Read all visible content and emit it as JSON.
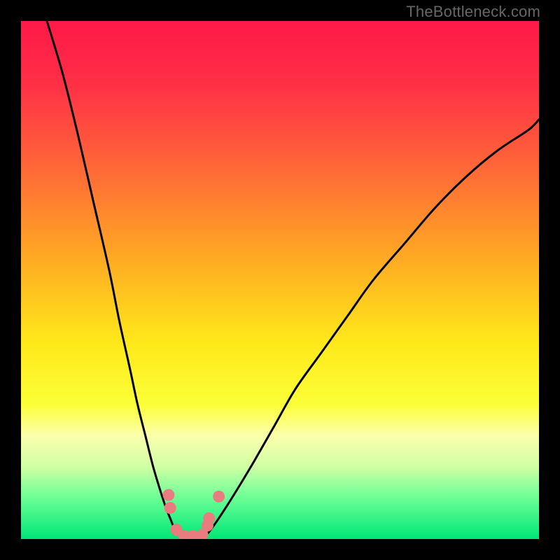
{
  "watermark": "TheBottleneck.com",
  "colors": {
    "black": "#000000",
    "curve": "#000000",
    "dot": "#e97c7e",
    "grad_stops": [
      {
        "p": 0.0,
        "c": "#ff1948"
      },
      {
        "p": 0.12,
        "c": "#ff2f46"
      },
      {
        "p": 0.28,
        "c": "#ff6638"
      },
      {
        "p": 0.45,
        "c": "#ffa724"
      },
      {
        "p": 0.62,
        "c": "#ffe81a"
      },
      {
        "p": 0.74,
        "c": "#fbff37"
      },
      {
        "p": 0.8,
        "c": "#fcffac"
      },
      {
        "p": 0.86,
        "c": "#d0ffa4"
      },
      {
        "p": 0.92,
        "c": "#6cff96"
      },
      {
        "p": 1.0,
        "c": "#00e676"
      }
    ]
  },
  "chart_data": {
    "type": "line",
    "title": "",
    "xlabel": "",
    "ylabel": "",
    "xlim": [
      0,
      100
    ],
    "ylim": [
      0,
      100
    ],
    "series": [
      {
        "name": "left-branch",
        "x": [
          5,
          8,
          11,
          14,
          17,
          19,
          21,
          22.5,
          24,
          25.5,
          27,
          28,
          28.8,
          29.4,
          30,
          30.5,
          31
        ],
        "y": [
          100,
          90,
          78,
          65,
          52,
          42,
          33,
          26,
          20,
          14,
          9,
          6,
          4,
          2.5,
          1.5,
          0.8,
          0
        ]
      },
      {
        "name": "right-branch",
        "x": [
          35,
          36,
          37.5,
          39.5,
          42,
          45,
          49,
          53,
          58,
          63,
          68,
          74,
          80,
          86,
          92,
          98,
          100
        ],
        "y": [
          0,
          1,
          3,
          6,
          10,
          15,
          22,
          29,
          36,
          43,
          50,
          57,
          64,
          70,
          75,
          79,
          81
        ]
      }
    ],
    "valley_floor": {
      "x_start": 31,
      "x_end": 35,
      "y": 0
    },
    "dots": [
      {
        "x": 28.5,
        "y": 8.5
      },
      {
        "x": 28.8,
        "y": 6.0
      },
      {
        "x": 30.0,
        "y": 1.8
      },
      {
        "x": 31.5,
        "y": 0.6
      },
      {
        "x": 33.2,
        "y": 0.6
      },
      {
        "x": 35.0,
        "y": 0.8
      },
      {
        "x": 36.0,
        "y": 2.6
      },
      {
        "x": 36.3,
        "y": 4.0
      },
      {
        "x": 38.2,
        "y": 8.2
      }
    ]
  }
}
